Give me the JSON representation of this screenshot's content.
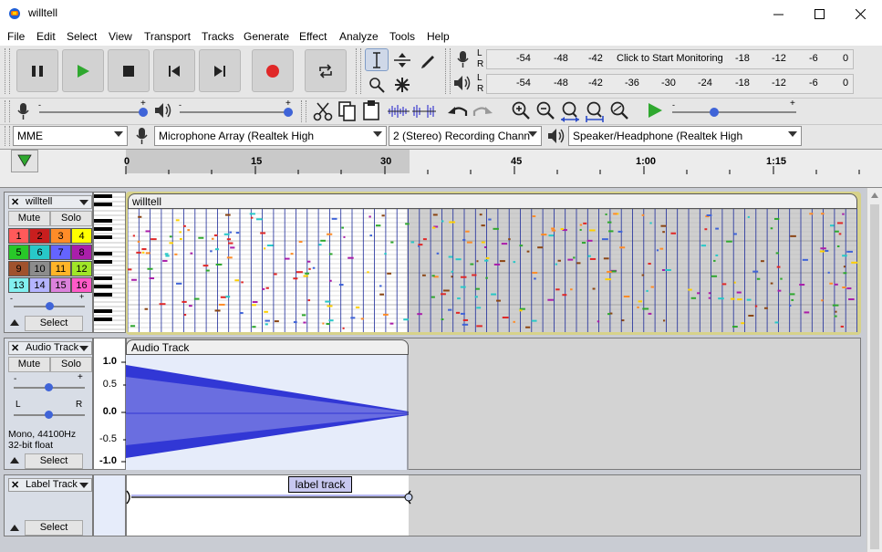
{
  "window": {
    "title": "willtell"
  },
  "menu": [
    "File",
    "Edit",
    "Select",
    "View",
    "Transport",
    "Tracks",
    "Generate",
    "Effect",
    "Analyze",
    "Tools",
    "Help"
  ],
  "meter": {
    "record_ticks": [
      "-54",
      "-48",
      "-42",
      "Click to Start Monitoring",
      "-18",
      "-12",
      "-6",
      "0"
    ],
    "play_ticks": [
      "-54",
      "-48",
      "-42",
      "-36",
      "-30",
      "-24",
      "-18",
      "-12",
      "-6",
      "0"
    ],
    "lr": [
      "L",
      "R"
    ]
  },
  "device": {
    "host": "MME",
    "mic": "Microphone Array (Realtek High",
    "channels": "2 (Stereo) Recording Chann",
    "speaker": "Speaker/Headphone (Realtek High"
  },
  "timeline": {
    "labels": [
      "0",
      "15",
      "30",
      "45",
      "1:00",
      "1:15"
    ]
  },
  "tracks": {
    "midi": {
      "name": "willtell",
      "clip": "willtell",
      "mute": "Mute",
      "solo": "Solo",
      "select": "Select",
      "channels": [
        "1",
        "2",
        "3",
        "4",
        "5",
        "6",
        "7",
        "8",
        "9",
        "10",
        "11",
        "12",
        "13",
        "14",
        "15",
        "16"
      ],
      "channel_colors": [
        "#ff5a5a",
        "#c81e1e",
        "#ff8c28",
        "#ffff00",
        "#28c828",
        "#28c8c8",
        "#6464ff",
        "#aa1eaa",
        "#a0522d",
        "#8c8c8c",
        "#ffb428",
        "#a0e628",
        "#82f0f0",
        "#b4b4ff",
        "#dc82dc",
        "#ff5ac8"
      ]
    },
    "audio": {
      "name": "Audio Track",
      "clip": "Audio Track",
      "mute": "Mute",
      "solo": "Solo",
      "gain_minus": "-",
      "gain_plus": "+",
      "pan_l": "L",
      "pan_r": "R",
      "info1": "Mono, 44100Hz",
      "info2": "32-bit float",
      "select": "Select",
      "scale": [
        "1.0",
        "0.5",
        "0.0",
        "-0.5",
        "-1.0"
      ]
    },
    "label": {
      "name": "Label Track",
      "select": "Select",
      "label_text": "label track"
    }
  }
}
